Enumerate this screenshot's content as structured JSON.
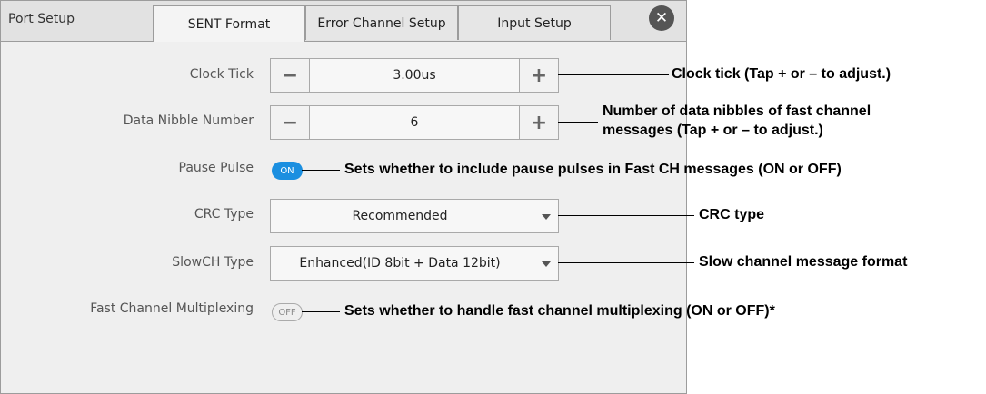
{
  "tabs": {
    "static_label": "Port Setup",
    "items": [
      {
        "label": "SENT Format",
        "active": true
      },
      {
        "label": "Error Channel Setup",
        "active": false
      },
      {
        "label": "Input Setup",
        "active": false
      }
    ],
    "close_symbol": "✕",
    "close_icon": "close-circle-icon"
  },
  "settings": {
    "clock_tick": {
      "label": "Clock Tick",
      "value": "3.00us",
      "minus": "−",
      "plus": "+"
    },
    "data_nibble": {
      "label": "Data Nibble Number",
      "value": "6",
      "minus": "−",
      "plus": "+"
    },
    "pause_pulse": {
      "label": "Pause Pulse",
      "state": "ON"
    },
    "crc_type": {
      "label": "CRC Type",
      "value": "Recommended"
    },
    "slowch_type": {
      "label": "SlowCH Type",
      "value": "Enhanced(ID 8bit + Data 12bit)"
    },
    "fast_mux": {
      "label": "Fast Channel Multiplexing",
      "state": "OFF"
    }
  },
  "callouts": {
    "clock_tick": "Clock tick (Tap + or – to adjust.)",
    "data_nibble_line1": "Number of data nibbles of fast channel",
    "data_nibble_line2": "messages (Tap + or – to adjust.)",
    "pause_pulse": "Sets whether to include pause pulses in Fast CH messages (ON or OFF)",
    "crc_type": "CRC type",
    "slowch_type": "Slow channel message format",
    "fast_mux": "Sets whether to handle fast channel multiplexing (ON or OFF)*"
  },
  "colors": {
    "toggle_on": "#1b8fe0",
    "panel_bg": "#efefef",
    "close_button": "#555555"
  }
}
